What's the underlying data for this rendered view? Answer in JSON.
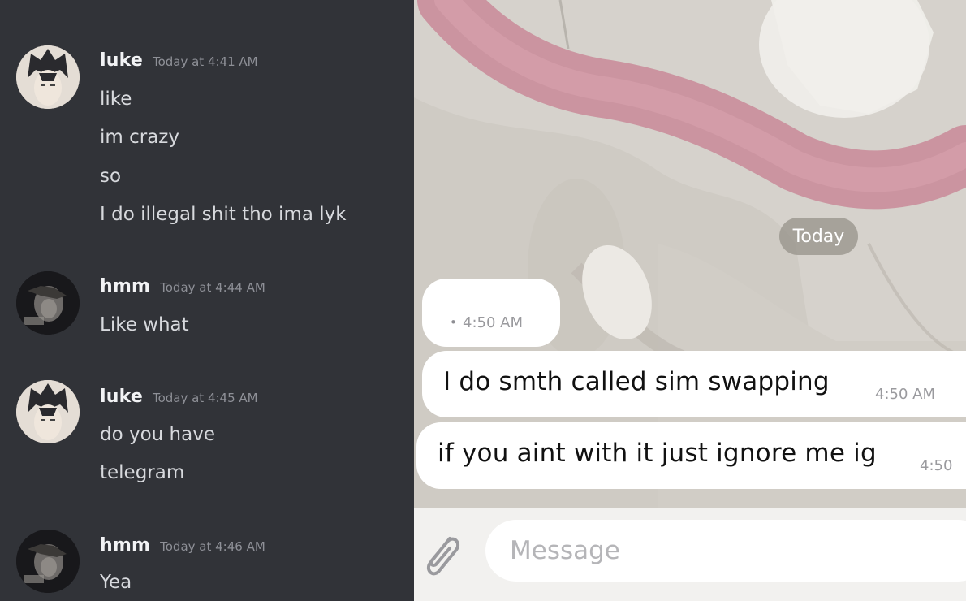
{
  "discord": {
    "groups": [
      {
        "username": "luke",
        "timestamp": "Today at 4:41 AM",
        "lines": [
          "like",
          "im crazy",
          "so",
          "I do illegal shit tho ima lyk"
        ]
      },
      {
        "username": "hmm",
        "timestamp": "Today at 4:44 AM",
        "lines": [
          "Like what"
        ]
      },
      {
        "username": "luke",
        "timestamp": "Today at 4:45 AM",
        "lines": [
          "do you have",
          "telegram"
        ]
      },
      {
        "username": "hmm",
        "timestamp": "Today at 4:46 AM",
        "lines": [
          "Yea"
        ]
      }
    ]
  },
  "telegram": {
    "date_label": "Today",
    "status_time": "4:50 AM",
    "messages": [
      {
        "text": "I do smth called sim swapping",
        "time": "4:50 AM"
      },
      {
        "text": "if you aint with it just ignore me ig",
        "time": "4:50"
      }
    ],
    "input": {
      "placeholder": "Message"
    },
    "attach_icon": "paperclip-icon"
  },
  "colors": {
    "discord_bg": "#313338",
    "telegram_bubble": "#ffffff",
    "wallpaper_pink": "#c98a98"
  }
}
